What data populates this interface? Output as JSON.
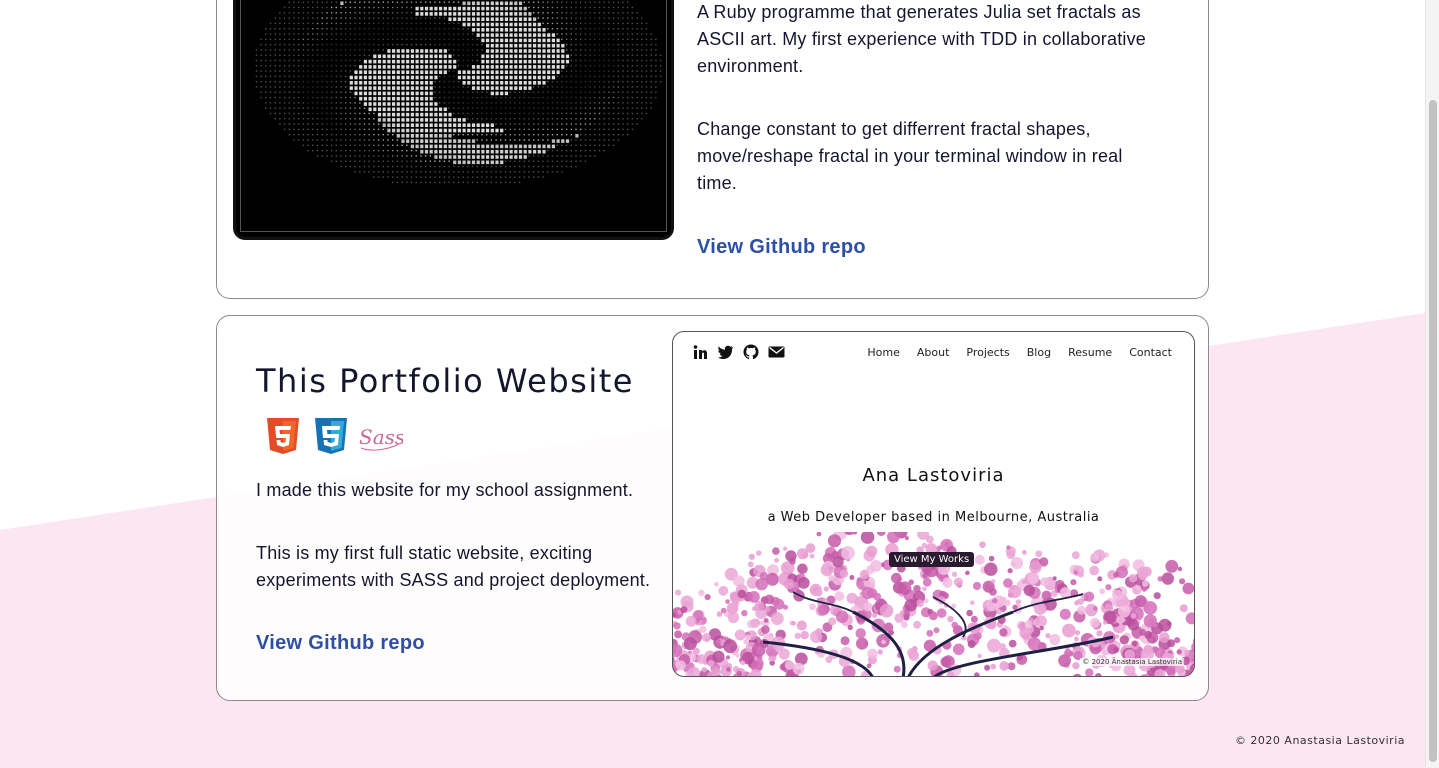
{
  "projects": [
    {
      "description": [
        "A Ruby programme that generates Julia set fractals as ASCII art. My first experience with TDD in collaborative environment.",
        "Change constant to get differrent fractal shapes, move/reshape fractal in your terminal window in real time."
      ],
      "link_label": "View Github repo"
    },
    {
      "title": "This Portfolio Website",
      "tech_icons": [
        "html5-icon",
        "css3-icon",
        "sass-icon"
      ],
      "description": [
        "I made this website for my school assignment.",
        "This is my first full static website, exciting experiments with SASS and project deployment."
      ],
      "link_label": "View Github repo",
      "preview": {
        "social_icons": [
          "linkedin-icon",
          "twitter-icon",
          "github-icon",
          "mail-icon"
        ],
        "nav": [
          "Home",
          "About",
          "Projects",
          "Blog",
          "Resume",
          "Contact"
        ],
        "name": "Ana Lastoviria",
        "tagline": "a Web Developer based in Melbourne, Australia",
        "button_label": "View My Works",
        "footer": "© 2020 Anastasia Lastoviria"
      }
    }
  ],
  "footer": "© 2020 Anastasia Lastoviria",
  "colors": {
    "link": "#2d4fa6",
    "pink_band": "#fce6f1",
    "text": "#15162e"
  }
}
